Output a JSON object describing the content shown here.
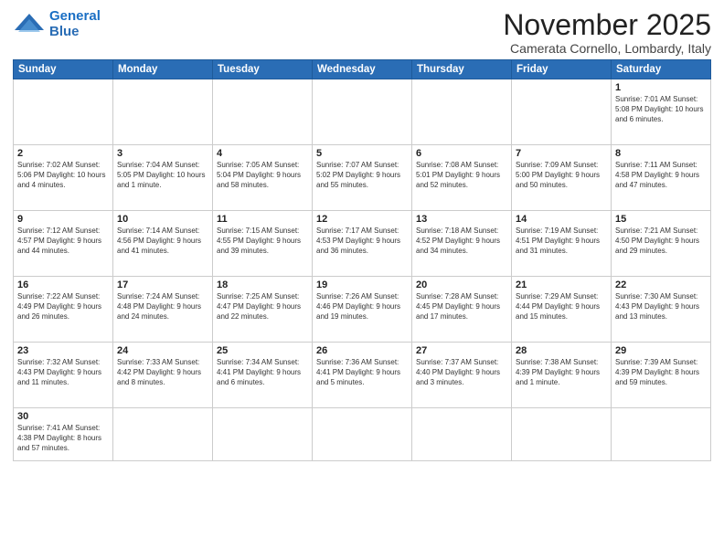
{
  "header": {
    "logo_general": "General",
    "logo_blue": "Blue",
    "month_title": "November 2025",
    "location": "Camerata Cornello, Lombardy, Italy"
  },
  "weekdays": [
    "Sunday",
    "Monday",
    "Tuesday",
    "Wednesday",
    "Thursday",
    "Friday",
    "Saturday"
  ],
  "weeks": [
    [
      {
        "day": "",
        "info": ""
      },
      {
        "day": "",
        "info": ""
      },
      {
        "day": "",
        "info": ""
      },
      {
        "day": "",
        "info": ""
      },
      {
        "day": "",
        "info": ""
      },
      {
        "day": "",
        "info": ""
      },
      {
        "day": "1",
        "info": "Sunrise: 7:01 AM\nSunset: 5:08 PM\nDaylight: 10 hours\nand 6 minutes."
      }
    ],
    [
      {
        "day": "2",
        "info": "Sunrise: 7:02 AM\nSunset: 5:06 PM\nDaylight: 10 hours\nand 4 minutes."
      },
      {
        "day": "3",
        "info": "Sunrise: 7:04 AM\nSunset: 5:05 PM\nDaylight: 10 hours\nand 1 minute."
      },
      {
        "day": "4",
        "info": "Sunrise: 7:05 AM\nSunset: 5:04 PM\nDaylight: 9 hours\nand 58 minutes."
      },
      {
        "day": "5",
        "info": "Sunrise: 7:07 AM\nSunset: 5:02 PM\nDaylight: 9 hours\nand 55 minutes."
      },
      {
        "day": "6",
        "info": "Sunrise: 7:08 AM\nSunset: 5:01 PM\nDaylight: 9 hours\nand 52 minutes."
      },
      {
        "day": "7",
        "info": "Sunrise: 7:09 AM\nSunset: 5:00 PM\nDaylight: 9 hours\nand 50 minutes."
      },
      {
        "day": "8",
        "info": "Sunrise: 7:11 AM\nSunset: 4:58 PM\nDaylight: 9 hours\nand 47 minutes."
      }
    ],
    [
      {
        "day": "9",
        "info": "Sunrise: 7:12 AM\nSunset: 4:57 PM\nDaylight: 9 hours\nand 44 minutes."
      },
      {
        "day": "10",
        "info": "Sunrise: 7:14 AM\nSunset: 4:56 PM\nDaylight: 9 hours\nand 41 minutes."
      },
      {
        "day": "11",
        "info": "Sunrise: 7:15 AM\nSunset: 4:55 PM\nDaylight: 9 hours\nand 39 minutes."
      },
      {
        "day": "12",
        "info": "Sunrise: 7:17 AM\nSunset: 4:53 PM\nDaylight: 9 hours\nand 36 minutes."
      },
      {
        "day": "13",
        "info": "Sunrise: 7:18 AM\nSunset: 4:52 PM\nDaylight: 9 hours\nand 34 minutes."
      },
      {
        "day": "14",
        "info": "Sunrise: 7:19 AM\nSunset: 4:51 PM\nDaylight: 9 hours\nand 31 minutes."
      },
      {
        "day": "15",
        "info": "Sunrise: 7:21 AM\nSunset: 4:50 PM\nDaylight: 9 hours\nand 29 minutes."
      }
    ],
    [
      {
        "day": "16",
        "info": "Sunrise: 7:22 AM\nSunset: 4:49 PM\nDaylight: 9 hours\nand 26 minutes."
      },
      {
        "day": "17",
        "info": "Sunrise: 7:24 AM\nSunset: 4:48 PM\nDaylight: 9 hours\nand 24 minutes."
      },
      {
        "day": "18",
        "info": "Sunrise: 7:25 AM\nSunset: 4:47 PM\nDaylight: 9 hours\nand 22 minutes."
      },
      {
        "day": "19",
        "info": "Sunrise: 7:26 AM\nSunset: 4:46 PM\nDaylight: 9 hours\nand 19 minutes."
      },
      {
        "day": "20",
        "info": "Sunrise: 7:28 AM\nSunset: 4:45 PM\nDaylight: 9 hours\nand 17 minutes."
      },
      {
        "day": "21",
        "info": "Sunrise: 7:29 AM\nSunset: 4:44 PM\nDaylight: 9 hours\nand 15 minutes."
      },
      {
        "day": "22",
        "info": "Sunrise: 7:30 AM\nSunset: 4:43 PM\nDaylight: 9 hours\nand 13 minutes."
      }
    ],
    [
      {
        "day": "23",
        "info": "Sunrise: 7:32 AM\nSunset: 4:43 PM\nDaylight: 9 hours\nand 11 minutes."
      },
      {
        "day": "24",
        "info": "Sunrise: 7:33 AM\nSunset: 4:42 PM\nDaylight: 9 hours\nand 8 minutes."
      },
      {
        "day": "25",
        "info": "Sunrise: 7:34 AM\nSunset: 4:41 PM\nDaylight: 9 hours\nand 6 minutes."
      },
      {
        "day": "26",
        "info": "Sunrise: 7:36 AM\nSunset: 4:41 PM\nDaylight: 9 hours\nand 5 minutes."
      },
      {
        "day": "27",
        "info": "Sunrise: 7:37 AM\nSunset: 4:40 PM\nDaylight: 9 hours\nand 3 minutes."
      },
      {
        "day": "28",
        "info": "Sunrise: 7:38 AM\nSunset: 4:39 PM\nDaylight: 9 hours\nand 1 minute."
      },
      {
        "day": "29",
        "info": "Sunrise: 7:39 AM\nSunset: 4:39 PM\nDaylight: 8 hours\nand 59 minutes."
      }
    ],
    [
      {
        "day": "30",
        "info": "Sunrise: 7:41 AM\nSunset: 4:38 PM\nDaylight: 8 hours\nand 57 minutes."
      },
      {
        "day": "",
        "info": ""
      },
      {
        "day": "",
        "info": ""
      },
      {
        "day": "",
        "info": ""
      },
      {
        "day": "",
        "info": ""
      },
      {
        "day": "",
        "info": ""
      },
      {
        "day": "",
        "info": ""
      }
    ]
  ]
}
